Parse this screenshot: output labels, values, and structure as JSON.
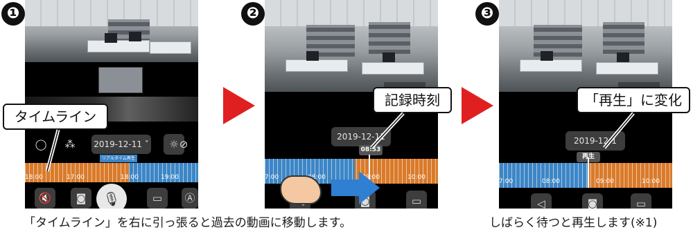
{
  "steps": [
    {
      "number": "❶",
      "callout": "タイムライン",
      "date_button": "2019-12-11 ˅",
      "rt_tag": "リアルタイム再生",
      "timeline_labels": [
        "18:00",
        "17:00",
        "18:00",
        "19:00"
      ]
    },
    {
      "number": "❷",
      "callout": "記録時刻",
      "date_button": "2019-12-11",
      "time_badge": "08:53",
      "timeline_labels": [
        "7:00",
        "08:00",
        "09:00",
        "10:00"
      ]
    },
    {
      "number": "❸",
      "callout": "「再生」に変化",
      "date_button": "2019-12-1",
      "play_badge": "再生",
      "timeline_labels": [
        "7:00",
        "08:00",
        "09:00",
        "10:00"
      ]
    }
  ],
  "captions": {
    "left": "「タイムライン」を右に引っ張ると過去の動画に移動します。",
    "right": "しばらく待つと再生します(※1)"
  },
  "colors": {
    "arrow": "#e02020",
    "timeline_orange": "#d97b2b",
    "timeline_blue": "#3d86c6"
  },
  "icons": [
    "mute-icon",
    "camera-icon",
    "mic-icon",
    "video-icon",
    "auto-icon",
    "brightness-icon",
    "speaker-icon",
    "focus-icon"
  ]
}
